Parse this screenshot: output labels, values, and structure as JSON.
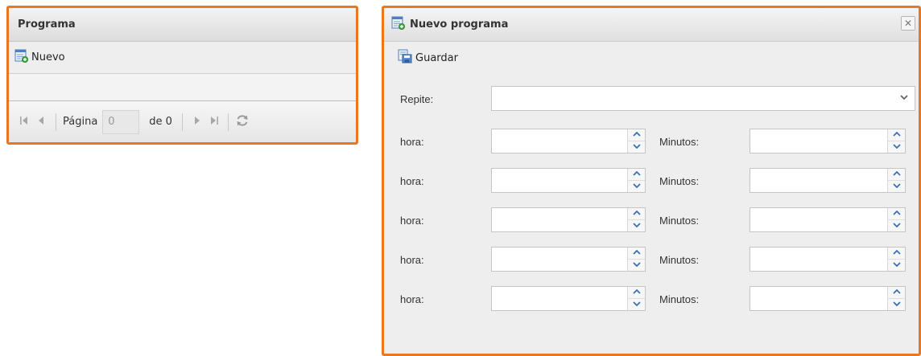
{
  "grid_panel": {
    "title": "Programa",
    "new_button_label": "Nuevo",
    "paging": {
      "page_label": "Página",
      "page_value": "0",
      "of_label": "de 0"
    }
  },
  "dialog": {
    "title": "Nuevo programa",
    "save_button_label": "Guardar",
    "repeat_label": "Repite:",
    "repeat_value": "",
    "time_rows": [
      {
        "hour_label": "hora:",
        "hour_value": "",
        "minutes_label": "Minutos:",
        "minutes_value": ""
      },
      {
        "hour_label": "hora:",
        "hour_value": "",
        "minutes_label": "Minutos:",
        "minutes_value": ""
      },
      {
        "hour_label": "hora:",
        "hour_value": "",
        "minutes_label": "Minutos:",
        "minutes_value": ""
      },
      {
        "hour_label": "hora:",
        "hour_value": "",
        "minutes_label": "Minutos:",
        "minutes_value": ""
      },
      {
        "hour_label": "hora:",
        "hour_value": "",
        "minutes_label": "Minutos:",
        "minutes_value": ""
      }
    ]
  },
  "icons": {
    "new": "add-document-icon",
    "save": "save-document-icon",
    "dialog": "form-document-icon",
    "close": "close-icon",
    "first": "first-page-icon",
    "prev": "previous-page-icon",
    "next": "next-page-icon",
    "last": "last-page-icon",
    "refresh": "refresh-icon"
  },
  "colors": {
    "highlight_border": "#e87722",
    "spinner_arrow": "#3b6fb6"
  }
}
